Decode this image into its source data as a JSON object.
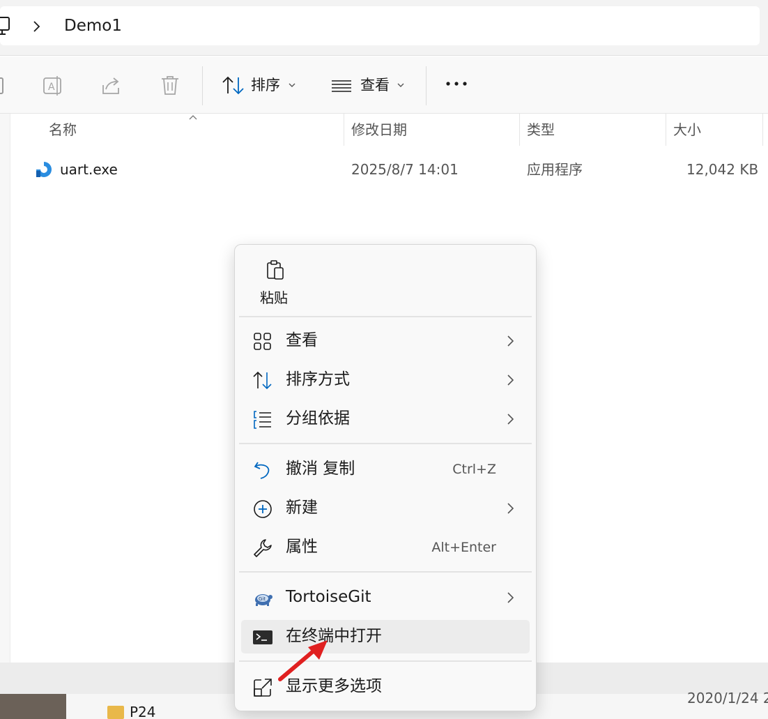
{
  "address": {
    "path_segment": "Demo1"
  },
  "toolbar": {
    "sort_label": "排序",
    "view_label": "查看"
  },
  "columns": [
    "名称",
    "修改日期",
    "类型",
    "大小"
  ],
  "files": [
    {
      "name": "uart.exe",
      "modified": "2025/8/7 14:01",
      "type": "应用程序",
      "size": "12,042 KB"
    }
  ],
  "context_menu": {
    "paste_label": "粘贴",
    "items": [
      {
        "label": "查看",
        "icon": "grid-view-icon",
        "submenu": true
      },
      {
        "label": "排序方式",
        "icon": "sort-icon",
        "submenu": true
      },
      {
        "label": "分组依据",
        "icon": "group-list-icon",
        "submenu": true
      },
      {
        "label": "撤消 复制",
        "icon": "undo-icon",
        "shortcut": "Ctrl+Z"
      },
      {
        "label": "新建",
        "icon": "plus-circle-icon",
        "submenu": true
      },
      {
        "label": "属性",
        "icon": "wrench-icon",
        "shortcut": "Alt+Enter"
      },
      {
        "label": "TortoiseGit",
        "icon": "tortoisegit-icon",
        "submenu": true
      },
      {
        "label": "在终端中打开",
        "icon": "terminal-icon",
        "hovered": true
      },
      {
        "label": "显示更多选项",
        "icon": "share-more-icon"
      }
    ]
  },
  "background_window": {
    "folder": "P24",
    "date": "2020/1/24 2"
  },
  "colors": {
    "accent": "#0067c0",
    "annotation_arrow": "#e02020",
    "menu_bg": "#f9f9f9"
  }
}
